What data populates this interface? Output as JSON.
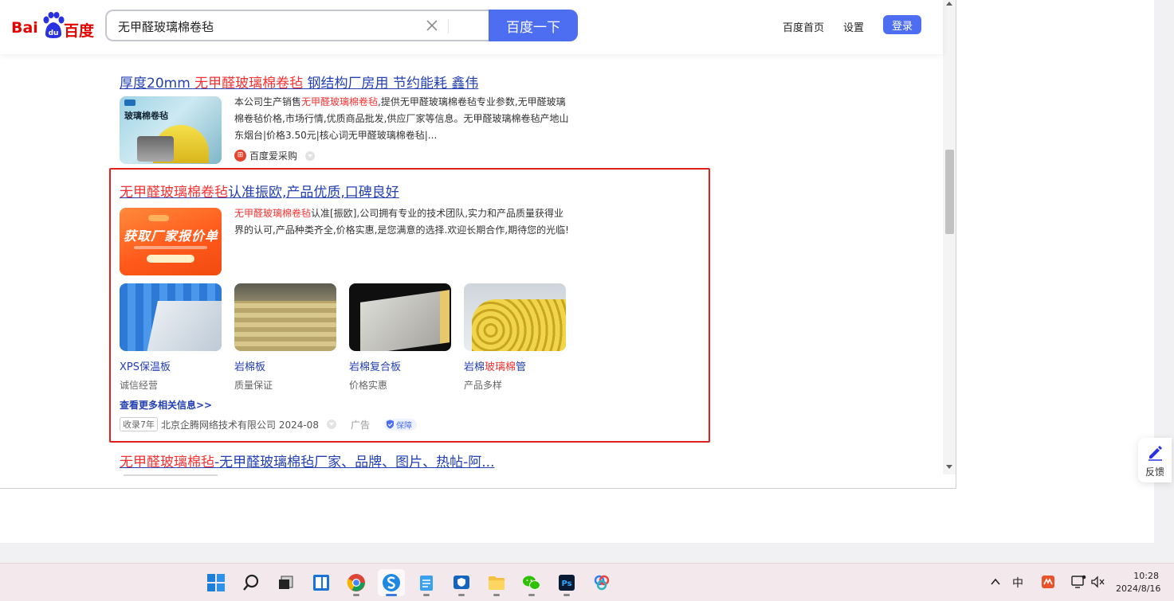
{
  "header": {
    "logo_left": "Bai",
    "logo_right": "百度",
    "search_value": "无甲醛玻璃棉卷毡",
    "search_button": "百度一下",
    "nav_home": "百度首页",
    "nav_settings": "设置",
    "login": "登录"
  },
  "results": [
    {
      "title_pre": "厚度20mm ",
      "title_hl": "无甲醛玻璃棉卷毡",
      "title_post": " 钢结构厂房用 节约能耗 鑫伟",
      "thumb_label": "玻璃棉卷毡",
      "snippet_pre": "本公司生产销售",
      "snippet_hl": "无甲醛玻璃棉卷毡",
      "snippet_post": ",提供无甲醛玻璃棉卷毡专业参数,无甲醛玻璃棉卷毡价格,市场行情,优质商品批发,供应厂家等信息。无甲醛玻璃棉卷毡产地山东烟台|价格3.50元|核心词无甲醛玻璃棉卷毡|...",
      "source": "百度爱采购"
    }
  ],
  "ad": {
    "title_hl": "无甲醛玻璃棉卷毡",
    "title_post": "认准振欧,产品优质,口碑良好",
    "banner_text": "获取厂家报价单",
    "snippet_hl": "无甲醛玻璃棉卷毡",
    "snippet_post": "认准[振欧],公司拥有专业的技术团队,实力和产品质量获得业界的认可,产品种类齐全,价格实惠,是您满意的选择.欢迎长期合作,期待您的光临!",
    "products": [
      {
        "name_pre": "XPS保温板",
        "name_hl": "",
        "name_post": "",
        "sub": "诚信经营"
      },
      {
        "name_pre": "岩棉板",
        "name_hl": "",
        "name_post": "",
        "sub": "质量保证"
      },
      {
        "name_pre": "岩棉复合板",
        "name_hl": "",
        "name_post": "",
        "sub": "价格实惠"
      },
      {
        "name_pre": "岩棉",
        "name_hl": "玻璃棉",
        "name_post": "管",
        "sub": "产品多样"
      }
    ],
    "more": "查看更多相关信息>>",
    "badge": "收录7年",
    "company": "北京企腾网络技术有限公司 2024-08",
    "ad_label": "广告",
    "guarantee": "保障"
  },
  "result3": {
    "title_hl": "无甲醛玻璃棉毡",
    "title_post": "-无甲醛玻璃棉毡厂家、品牌、图片、热帖-阿..."
  },
  "feedback": "反馈",
  "taskbar": {
    "tray_ime": "中",
    "time": "10:28",
    "date": "2024/8/16"
  },
  "colors": {
    "accent": "#4e6ef2",
    "link": "#2440b3",
    "highlight": "#f73131",
    "ad_border": "#e0201e"
  }
}
